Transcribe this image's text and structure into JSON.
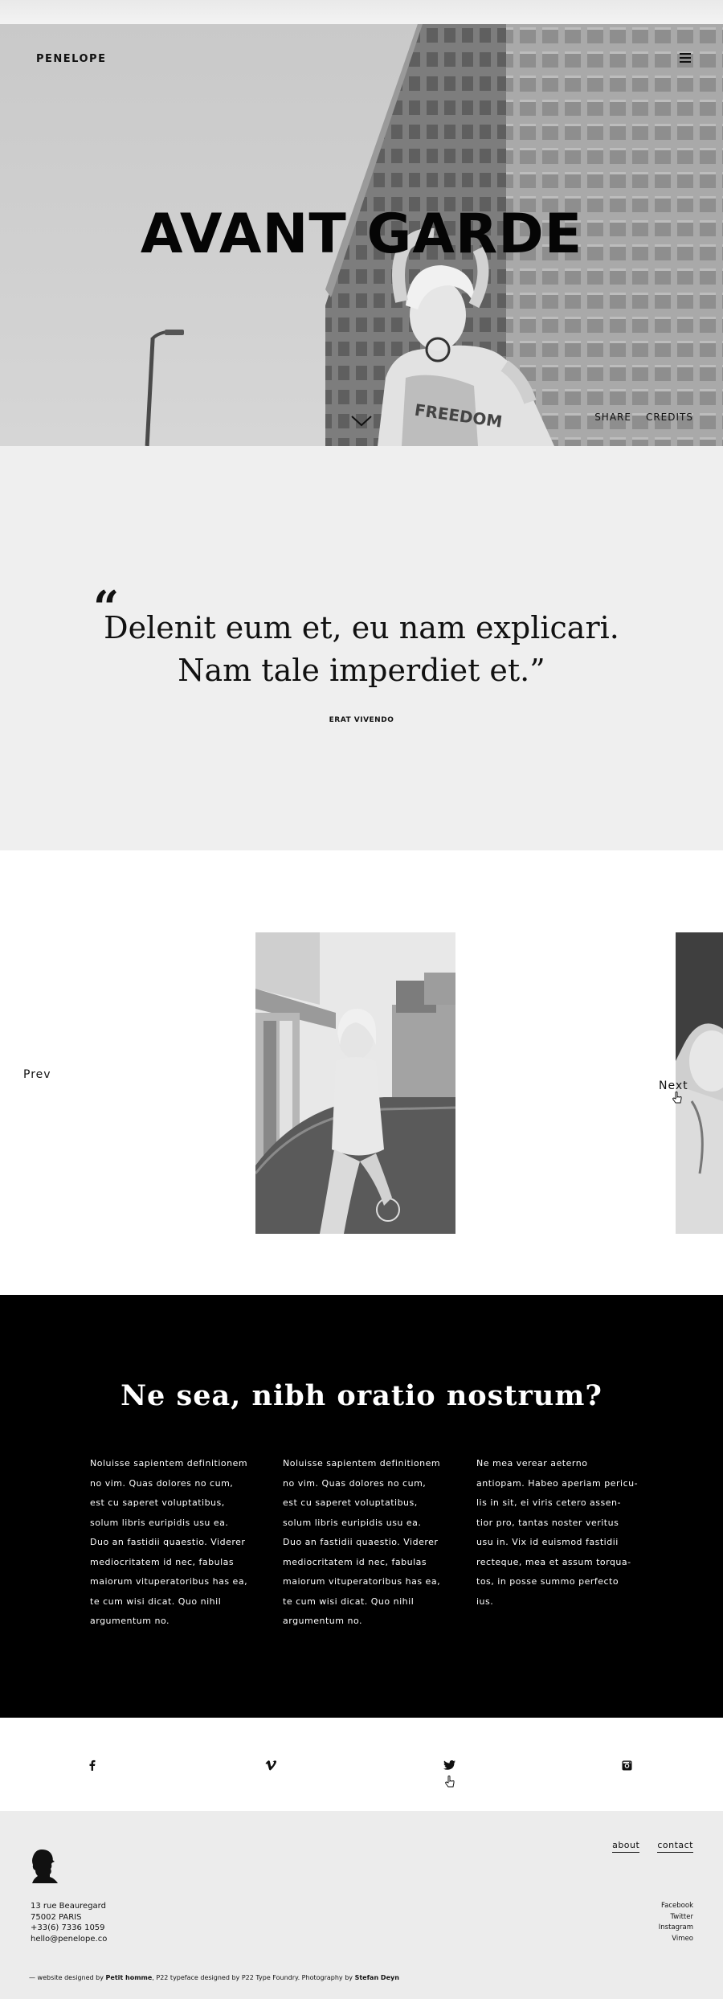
{
  "header": {
    "brand": "PENELOPE",
    "title": "AVANT GARDE",
    "links": [
      "SHARE",
      "CREDITS"
    ]
  },
  "quote": {
    "open_mark": "“",
    "line1": "Delenit eum et, eu nam explicari.",
    "line2": "Nam tale imperdiet et.”",
    "author": "ERAT VIVENDO"
  },
  "gallery": {
    "prev_label": "Prev",
    "next_label": "Next"
  },
  "dark": {
    "title": "Ne sea, nibh oratio nostrum?",
    "col1": [
      "Noluisse sapientem definitionem",
      "no vim. Quas dolores no cum,",
      "est cu saperet voluptatibus,",
      "solum libris euripidis usu ea.",
      "Duo an fastidii quaestio. Viderer",
      "mediocritatem id nec, fabulas",
      "maiorum vituperatoribus has ea,",
      "te cum wisi dicat. Quo nihil",
      "argumentum no."
    ],
    "col2": [
      "Noluisse sapientem definitionem",
      "no vim. Quas dolores no cum,",
      "est cu saperet voluptatibus,",
      "solum libris euripidis usu ea.",
      "Duo an fastidii quaestio. Viderer",
      "mediocritatem id nec, fabulas",
      "maiorum vituperatoribus has ea,",
      "te cum wisi dicat. Quo nihil",
      "argumentum no."
    ],
    "col3": [
      "Ne mea verear aeterno",
      "antiopam. Habeo aperiam pericu-",
      "lis in sit, ei viris cetero assen-",
      "tior pro, tantas noster veritus",
      "usu in. Vix id euismod fastidii",
      "recteque, mea et assum torqua-",
      "tos, in posse summo perfecto",
      "ius."
    ]
  },
  "social_icons": [
    "facebook-icon",
    "vimeo-icon",
    "twitter-icon",
    "instagram-icon"
  ],
  "footer": {
    "nav": [
      "about",
      "contact"
    ],
    "address": [
      "13 rue Beauregard",
      "75002 PARIS",
      "+33(6) 7336 1059",
      "hello@penelope.co"
    ],
    "social_links": [
      "Facebook",
      "Twitter",
      "Instagram",
      "Vimeo"
    ],
    "credits": {
      "prefix": "— website designed by",
      "designer": "Petit homme",
      "mid": ", P22 typeface designed by P22 Type Foundry. Photography by",
      "photographer": "Stefan Deyn"
    }
  }
}
